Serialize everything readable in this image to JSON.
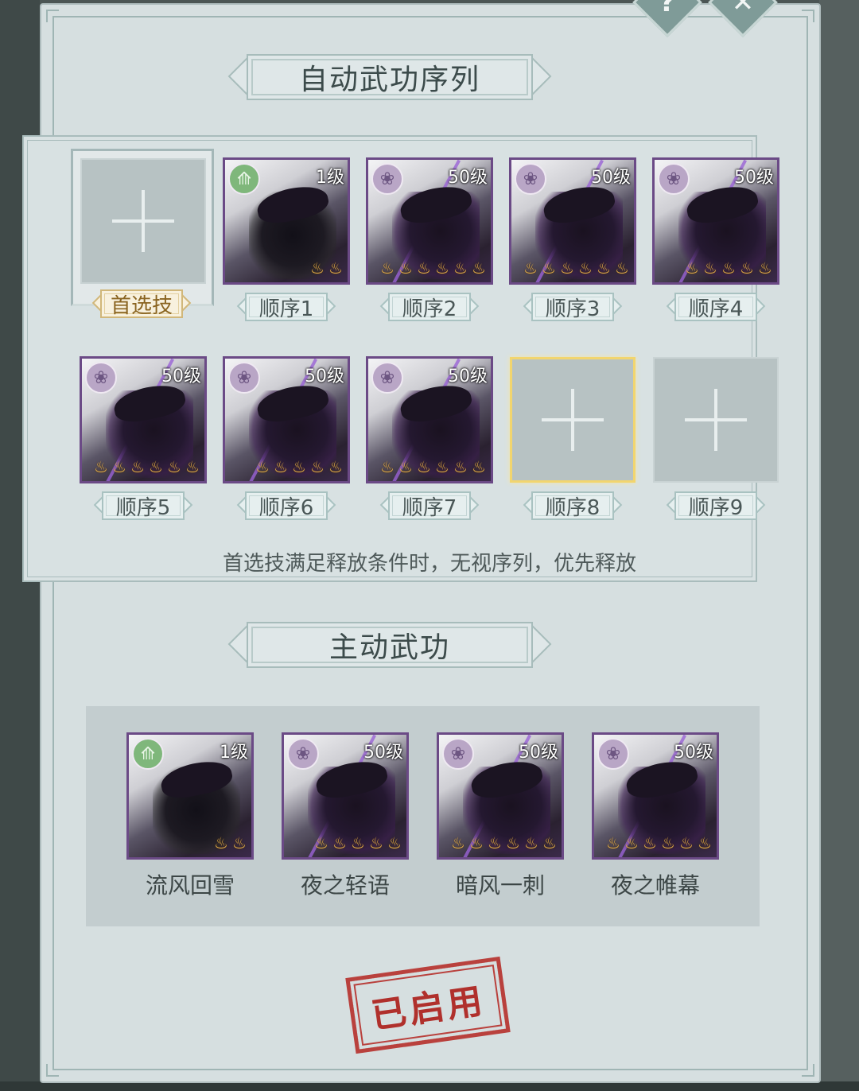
{
  "top_buttons": {
    "help_icon": "?",
    "close_icon": "✕"
  },
  "auto_sequence": {
    "title": "自动武功序列",
    "preferred": {
      "label": "首选技",
      "empty": true
    },
    "slots": [
      {
        "label": "顺序1",
        "level": "1级",
        "emblem": "green-leaf",
        "stars": 2,
        "empty": false
      },
      {
        "label": "顺序2",
        "level": "50级",
        "emblem": "purple-rose",
        "stars": 6,
        "empty": false
      },
      {
        "label": "顺序3",
        "level": "50级",
        "emblem": "purple-rose",
        "stars": 6,
        "empty": false
      },
      {
        "label": "顺序4",
        "level": "50级",
        "emblem": "purple-rose",
        "stars": 5,
        "empty": false
      },
      {
        "label": "顺序5",
        "level": "50级",
        "emblem": "purple-rose",
        "stars": 6,
        "empty": false
      },
      {
        "label": "顺序6",
        "level": "50级",
        "emblem": "purple-rose",
        "stars": 5,
        "empty": false
      },
      {
        "label": "顺序7",
        "level": "50级",
        "emblem": "purple-rose",
        "stars": 6,
        "empty": false
      },
      {
        "label": "顺序8",
        "empty": true,
        "highlighted": true
      },
      {
        "label": "顺序9",
        "empty": true
      }
    ],
    "note": "首选技满足释放条件时，无视序列，优先释放"
  },
  "active_skills": {
    "title": "主动武功",
    "skills": [
      {
        "name": "流风回雪",
        "level": "1级",
        "emblem": "green-leaf",
        "stars": 2
      },
      {
        "name": "夜之轻语",
        "level": "50级",
        "emblem": "purple-rose",
        "stars": 5
      },
      {
        "name": "暗风一刺",
        "level": "50级",
        "emblem": "purple-rose",
        "stars": 6
      },
      {
        "name": "夜之帷幕",
        "level": "50级",
        "emblem": "purple-rose",
        "stars": 6
      }
    ]
  },
  "stamp": {
    "text": "已启用",
    "color": "#b0302c"
  },
  "colors": {
    "panel": "#d6dfe0",
    "card_border": "#6b4a86",
    "star": "#e6b04a",
    "highlight": "#f2d56e"
  }
}
